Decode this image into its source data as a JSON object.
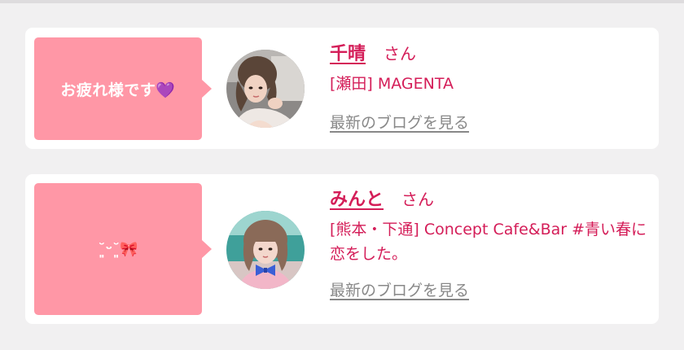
{
  "colors": {
    "accent": "#d41d58",
    "bubble": "#ff97a6",
    "link_gray": "#888888",
    "background": "#f1f0f1",
    "card": "#ffffff"
  },
  "entries": [
    {
      "message": "お疲れ様です💜",
      "name": "千晴",
      "honorific": "さん",
      "shop": "[瀬田] MAGENTA",
      "blog_link": "最新のブログを見る",
      "avatar_icon": "user-photo-icon"
    },
    {
      "message": "˘͈ᵕ˘͈🎀",
      "name": "みんと",
      "honorific": "さん",
      "shop": "[熊本・下通] Concept Cafe&Bar #青い春に恋をした。",
      "blog_link": "最新のブログを見る",
      "avatar_icon": "user-photo-icon"
    }
  ]
}
